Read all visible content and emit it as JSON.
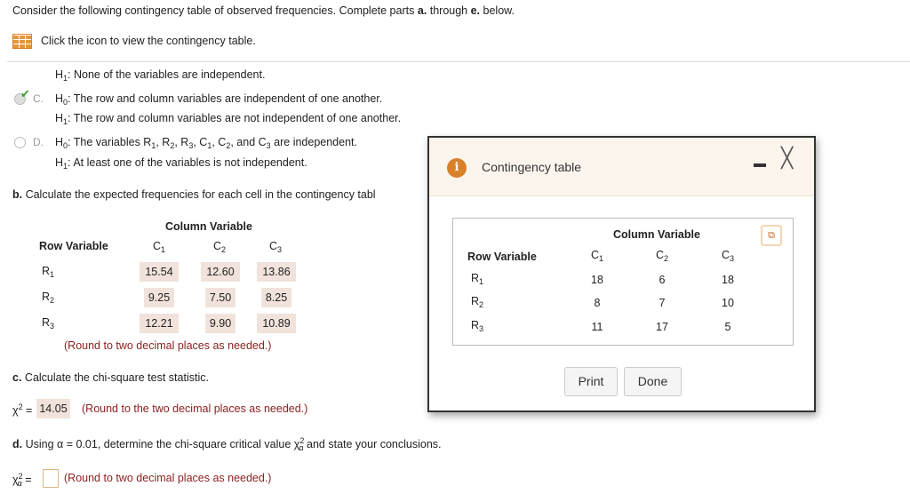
{
  "intro": {
    "pre": "Consider the following contingency table of observed frequencies. Complete parts ",
    "a": "a.",
    "mid": " through ",
    "e": "e.",
    "post": " below."
  },
  "icon_link": "Click the icon to view the contingency table.",
  "hypotheses": {
    "prev_h1": {
      "H": "H",
      "sub": "1",
      "text": ": None of the variables are independent."
    },
    "c": {
      "label": "C.",
      "h0": "The row and column variables are independent of one another.",
      "h1": "The row and column variables are not independent of one another.",
      "selected": true
    },
    "d": {
      "label": "D.",
      "h0_pre": "The variables R",
      "h0_mid": "and C",
      "h0_post": "are independent.",
      "h1": "At least one of the variables is not independent.",
      "selected": false
    }
  },
  "part_b": {
    "label": "b.",
    "text": " Calculate the expected frequencies for each cell in the contingency tabl",
    "column_variable": "Column Variable",
    "row_variable": "Row Variable",
    "cols": [
      "1",
      "2",
      "3"
    ],
    "rows": [
      "1",
      "2",
      "3"
    ],
    "values": [
      [
        "15.54",
        "12.60",
        "13.86"
      ],
      [
        "9.25",
        "7.50",
        "8.25"
      ],
      [
        "12.21",
        "9.90",
        "10.89"
      ]
    ],
    "note": "(Round to two decimal places as needed.)"
  },
  "part_c": {
    "label": "c.",
    "text": " Calculate the chi-square test statistic.",
    "chi": "χ",
    "sup": "2",
    "value": "14.05",
    "note": "(Round to the two decimal places as needed.)"
  },
  "part_d": {
    "label": "d.",
    "text_pre": " Using ",
    "alpha": "α",
    "text_mid": " = 0.01, determine the chi-square critical value ",
    "text_post": " and state your conclusions.",
    "chi": "χ",
    "sup": "2",
    "input_value": "",
    "note": "(Round to two decimal places as needed.)"
  },
  "modal": {
    "title": "Contingency table",
    "column_variable": "Column Variable",
    "row_variable": "Row Variable",
    "cols": [
      "1",
      "2",
      "3"
    ],
    "rows": [
      "1",
      "2",
      "3"
    ],
    "values": [
      [
        "18",
        "6",
        "18"
      ],
      [
        "8",
        "7",
        "10"
      ],
      [
        "11",
        "17",
        "5"
      ]
    ],
    "print": "Print",
    "done": "Done"
  },
  "colors": {
    "accent": "#d9822b",
    "note": "#8b1f1f",
    "cell": "#f1e3db"
  }
}
